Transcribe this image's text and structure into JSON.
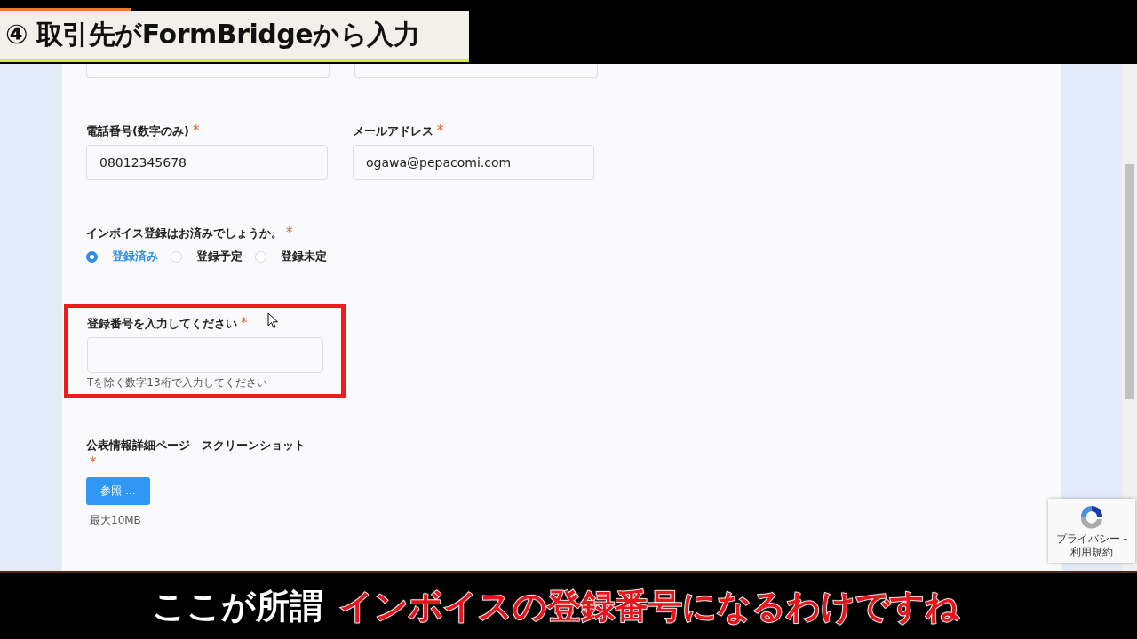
{
  "header": {
    "title": "④ 取引先がFormBridgeから入力"
  },
  "contact_fields": [
    {
      "label": "電話番号(数字のみ)",
      "required_mark": "*",
      "value": "08012345678"
    },
    {
      "label": "メールアドレス",
      "required_mark": "*",
      "value": "ogawa@pepacomi.com"
    }
  ],
  "invoice_question": {
    "label": "インボイス登録はお済みでしょうか。",
    "required_mark": "*",
    "options": [
      {
        "label": "登録済み",
        "selected": true
      },
      {
        "label": "登録予定",
        "selected": false
      },
      {
        "label": "登録未定",
        "selected": false
      }
    ]
  },
  "registration_number": {
    "label": "登録番号を入力してください",
    "required_mark": "*",
    "hint": "Tを除く数字13桁で入力してください",
    "highlighted": true
  },
  "upload": {
    "label": "公表情報詳細ページ　スクリーンショット",
    "required_mark": "*",
    "button": "参照 ...",
    "note": "最大10MB"
  },
  "recaptcha": {
    "links": [
      "プライバシー -",
      "利用規約"
    ]
  },
  "caption": {
    "parts": [
      {
        "text": "ここが所謂",
        "kind": "plain"
      },
      {
        "text": "インボイスの登録番号になるわけですね",
        "kind": "emphasis"
      }
    ]
  }
}
